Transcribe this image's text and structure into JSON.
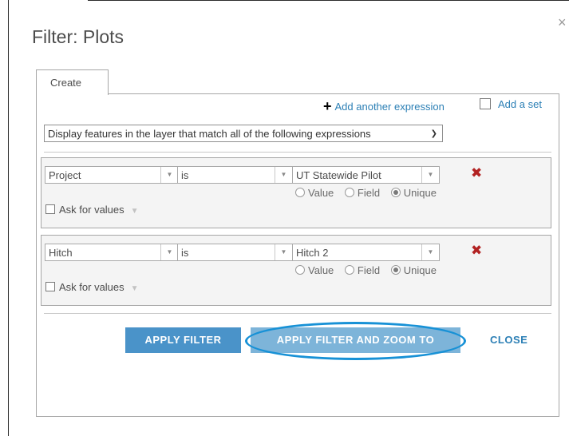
{
  "background_fragment": "...my ... ... ...",
  "dialog": {
    "title": "Filter: Plots",
    "close_label": "×",
    "tab_label": "Create",
    "add_expression_label": "Add another expression",
    "add_set_label": "Add a set",
    "match_select_value": "Display features in the layer that match all of the following expressions",
    "expressions": [
      {
        "field": "Project",
        "operator": "is",
        "value": "UT Statewide Pilot",
        "radio_value": "Value",
        "radio_field": "Field",
        "radio_unique": "Unique",
        "selected_source": "Unique",
        "ask_for_values": "Ask for values"
      },
      {
        "field": "Hitch",
        "operator": "is",
        "value": "Hitch 2",
        "radio_value": "Value",
        "radio_field": "Field",
        "radio_unique": "Unique",
        "selected_source": "Unique",
        "ask_for_values": "Ask for values"
      }
    ],
    "buttons": {
      "apply_filter": "APPLY FILTER",
      "apply_filter_zoom": "APPLY FILTER AND ZOOM TO",
      "close": "CLOSE"
    }
  },
  "colors": {
    "accent_blue": "#4a93c9",
    "highlight_ring": "#1791d6",
    "link_blue": "#2b7fb5",
    "delete_red": "#b22222"
  },
  "icons": {
    "plus": "plus-icon",
    "delete": "delete-x-icon",
    "dropdown": "chevron-down-icon"
  }
}
